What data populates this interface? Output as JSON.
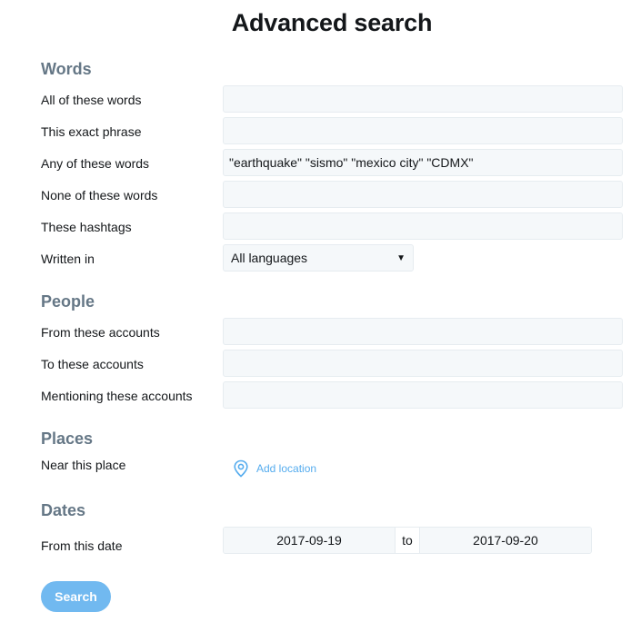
{
  "page": {
    "title": "Advanced search"
  },
  "words": {
    "heading": "Words",
    "all_label": "All of these words",
    "all_value": "",
    "exact_label": "This exact phrase",
    "exact_value": "",
    "any_label": "Any of these words",
    "any_value": "\"earthquake\" \"sismo\" \"mexico city\" \"CDMX\"",
    "none_label": "None of these words",
    "none_value": "",
    "hashtags_label": "These hashtags",
    "hashtags_value": "",
    "language_label": "Written in",
    "language_selected": "All languages"
  },
  "people": {
    "heading": "People",
    "from_label": "From these accounts",
    "from_value": "",
    "to_label": "To these accounts",
    "to_value": "",
    "mentioning_label": "Mentioning these accounts",
    "mentioning_value": ""
  },
  "places": {
    "heading": "Places",
    "near_label": "Near this place",
    "add_location_label": "Add location",
    "location_icon": "map-pin-icon"
  },
  "dates": {
    "heading": "Dates",
    "from_label": "From this date",
    "from_value": "2017-09-19",
    "separator": "to",
    "to_value": "2017-09-20"
  },
  "actions": {
    "search_label": "Search"
  },
  "colors": {
    "accent": "#55acee",
    "button": "#71b9f0",
    "input_bg": "#f5f8fa",
    "section_heading": "#657786"
  }
}
